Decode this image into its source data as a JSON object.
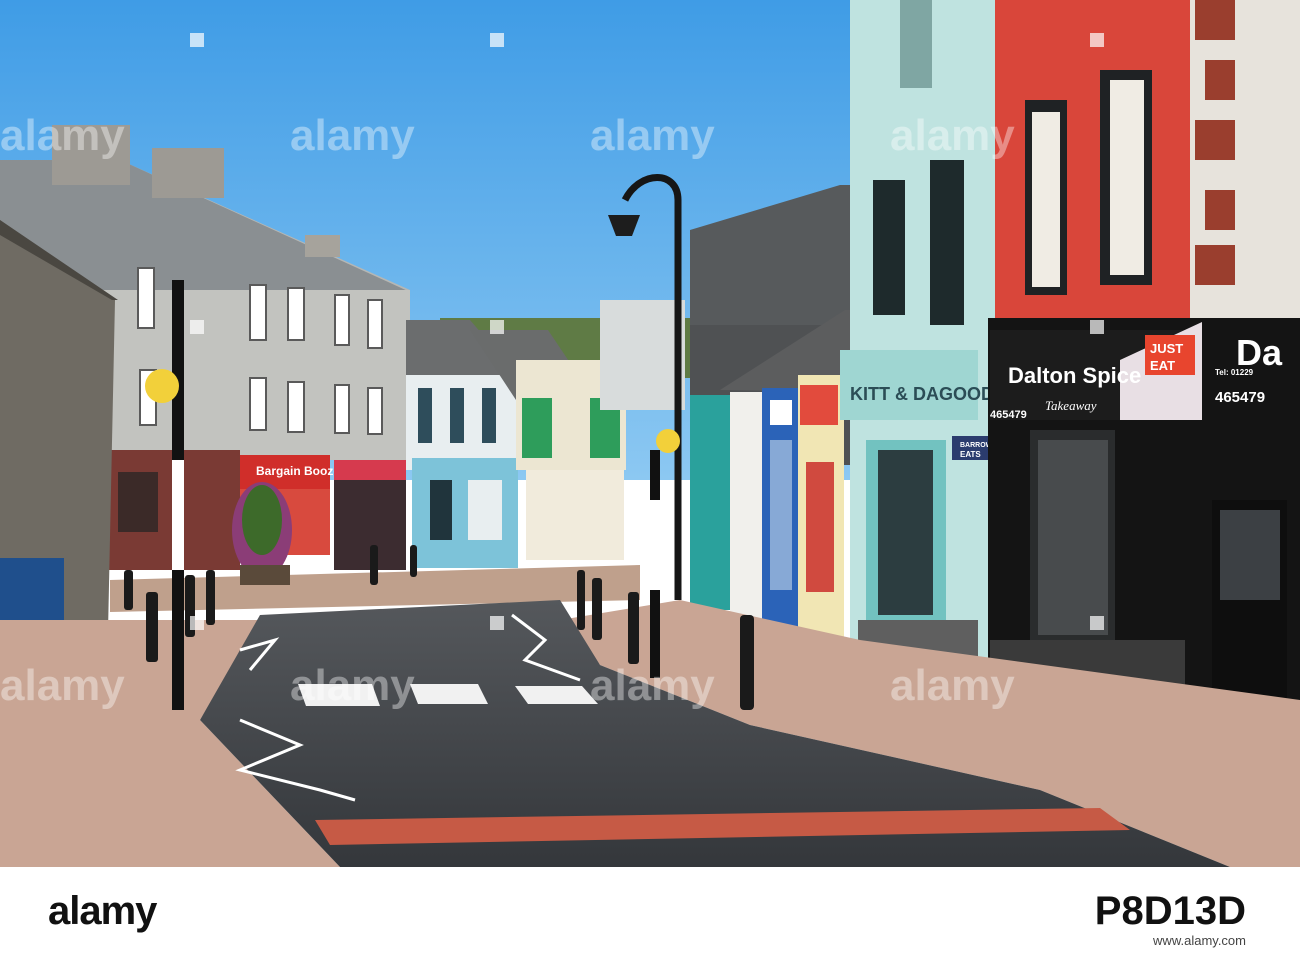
{
  "signs": {
    "bargain_booze": "Bargain Booze",
    "dalton_spice": "Dalton Spice",
    "takeaway": "Takeaway",
    "phone_left": "465479",
    "phone_right": "465479",
    "tel_small": "Tel: 01229",
    "just": "JUST",
    "eat": "EAT",
    "barrow": "BARROW",
    "eats": "EATS",
    "kitt_dagood": "KITT & DAGOOD E",
    "ds": "Da"
  },
  "watermark": {
    "logo": "alamy",
    "id": "P8D13D",
    "url": "www.alamy.com"
  },
  "colors": {
    "sky": "#4aa3e8",
    "red_building": "#d9463a",
    "mint_building": "#bfe3e0",
    "takeaway_front": "#141414",
    "road": "#3f4246",
    "pavement": "#c9a594"
  }
}
